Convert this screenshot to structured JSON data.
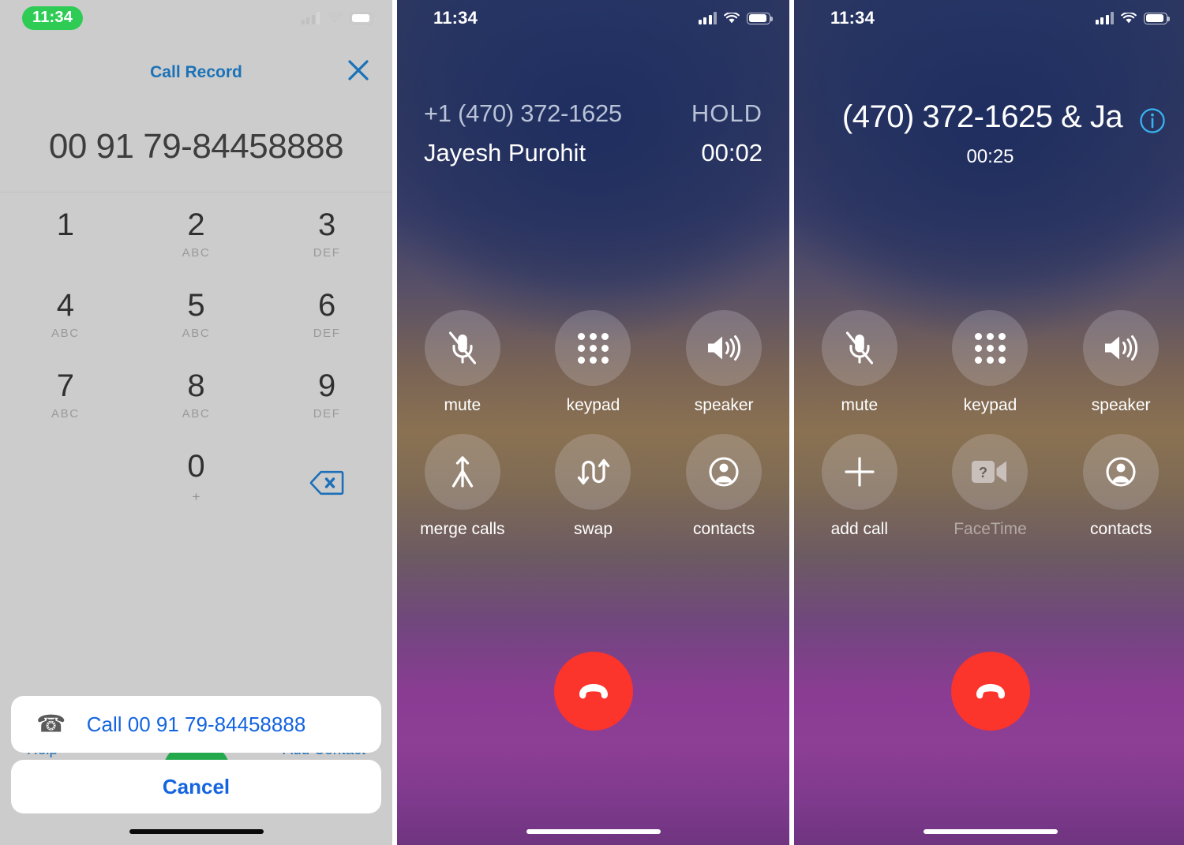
{
  "panels": {
    "dialer": {
      "status": {
        "time": "11:34",
        "signal_icon": "cellular-bars-icon",
        "wifi_icon": "wifi-icon",
        "battery_icon": "battery-icon"
      },
      "header": {
        "title": "Call Record",
        "close_icon": "close-x-icon"
      },
      "number_display": "00 91 79-84458888",
      "keys": [
        {
          "digit": "1",
          "letters": ""
        },
        {
          "digit": "2",
          "letters": "ABC"
        },
        {
          "digit": "3",
          "letters": "DEF"
        },
        {
          "digit": "4",
          "letters": "ABC"
        },
        {
          "digit": "5",
          "letters": "ABC"
        },
        {
          "digit": "6",
          "letters": "DEF"
        },
        {
          "digit": "7",
          "letters": "ABC"
        },
        {
          "digit": "8",
          "letters": "ABC"
        },
        {
          "digit": "9",
          "letters": "DEF"
        },
        {
          "digit": "0",
          "letters": "+"
        }
      ],
      "delete_icon": "backspace-delete-icon",
      "behind_sheet": {
        "help_label": "Help",
        "add_contact_label": "Add Contact",
        "call_button_icon": "green-call-button"
      },
      "action_sheet": {
        "call_icon": "phone-handset-icon",
        "call_label": "Call 00 91 79-84458888",
        "cancel_label": "Cancel"
      }
    },
    "incall_hold": {
      "status": {
        "time": "11:34",
        "signal_icon": "cellular-bars-icon",
        "wifi_icon": "wifi-icon",
        "battery_icon": "battery-icon"
      },
      "line1_number": "+1 (470) 372-1625",
      "line1_state": "HOLD",
      "line2_name": "Jayesh Purohit",
      "line2_timer": "00:02",
      "controls": [
        {
          "label": "mute",
          "icon": "microphone-muted-icon",
          "disabled": false
        },
        {
          "label": "keypad",
          "icon": "keypad-dots-icon",
          "disabled": false
        },
        {
          "label": "speaker",
          "icon": "speaker-waves-icon",
          "disabled": false
        },
        {
          "label": "merge calls",
          "icon": "merge-arrow-icon",
          "disabled": false
        },
        {
          "label": "swap",
          "icon": "swap-arrows-icon",
          "disabled": false
        },
        {
          "label": "contacts",
          "icon": "contacts-person-icon",
          "disabled": false
        }
      ],
      "end_call_icon": "end-call-handset-icon"
    },
    "incall_merged": {
      "status": {
        "time": "11:34",
        "signal_icon": "cellular-bars-icon",
        "wifi_icon": "wifi-icon",
        "battery_icon": "battery-icon"
      },
      "title": "(470) 372-1625 & Ja",
      "info_icon": "info-circle-icon",
      "timer": "00:25",
      "controls": [
        {
          "label": "mute",
          "icon": "microphone-muted-icon",
          "disabled": false
        },
        {
          "label": "keypad",
          "icon": "keypad-dots-icon",
          "disabled": false
        },
        {
          "label": "speaker",
          "icon": "speaker-waves-icon",
          "disabled": false
        },
        {
          "label": "add call",
          "icon": "plus-icon",
          "disabled": false
        },
        {
          "label": "FaceTime",
          "icon": "facetime-unavailable-icon",
          "disabled": true
        },
        {
          "label": "contacts",
          "icon": "contacts-person-icon",
          "disabled": false
        }
      ],
      "end_call_icon": "end-call-handset-icon"
    }
  },
  "colors": {
    "accent_blue": "#1464e0",
    "header_blue": "#1a72b8",
    "status_green": "#2ecc55",
    "call_green": "#23a94c",
    "end_call_red": "#fb342c",
    "dialer_bg": "#cccccc"
  }
}
